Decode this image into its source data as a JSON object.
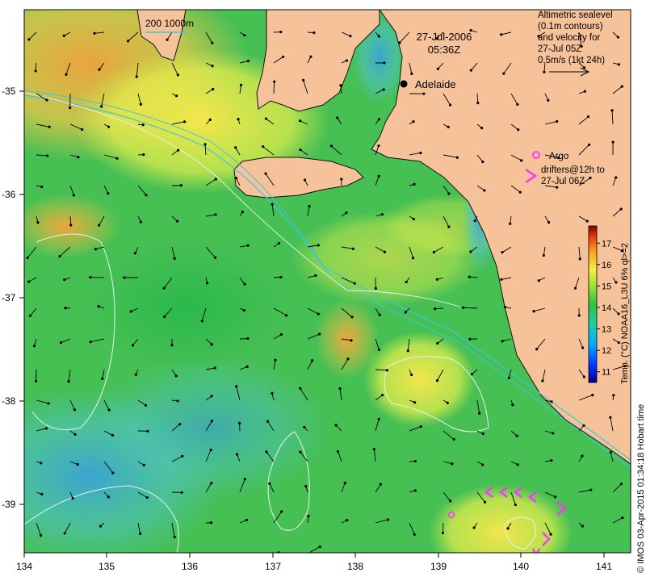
{
  "map": {
    "date": "27-Jul-2006",
    "time": "05:36Z",
    "city": "Adelaide",
    "scale_label": "200  1000m",
    "sealevel_lines": [
      "Altimetric sealevel",
      "(0.1m contours)",
      "and velocity for",
      "27-Jul 05Z",
      "0.5m/s (1kt 24h)"
    ],
    "argo_label": "Argo",
    "drifter_lines": [
      "drifters@12h to",
      "27-Jul 06Z"
    ],
    "colorbar_label": "Temp. (°C) NOAA16_L3U 6% ql>=2",
    "credit": "© IMOS 03-Apr-2015 01:34:18 Hobart time",
    "x_ticks": [
      "134",
      "135",
      "136",
      "137",
      "138",
      "139",
      "140",
      "141"
    ],
    "y_ticks": [
      "-35",
      "-36",
      "-37",
      "-38",
      "-39"
    ],
    "colorbar_ticks": [
      "11",
      "12",
      "13",
      "14",
      "15",
      "16",
      "17"
    ],
    "colorbar_range": [
      10.5,
      17.8
    ],
    "lon_range": [
      134,
      141.3
    ],
    "lat_range": [
      -39.5,
      -34.3
    ],
    "colors": {
      "land": "#f6c29a",
      "coast": "#111111",
      "contour": "#e8f3ee",
      "isobath": "#39c7e0",
      "drifter": "#ff33ff",
      "arrow": "#000000"
    }
  }
}
